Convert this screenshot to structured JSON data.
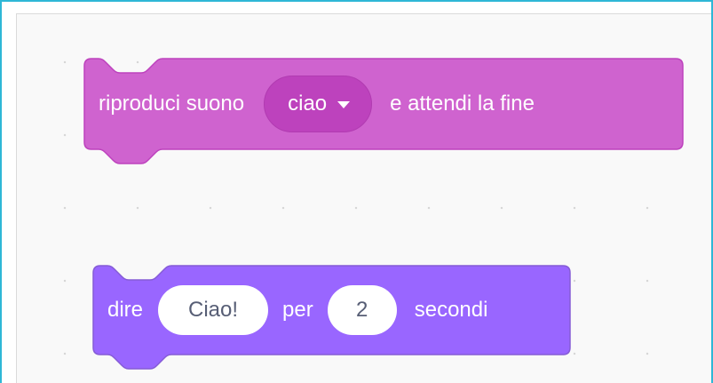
{
  "colors": {
    "sound_block": "#cf63cf",
    "sound_block_border": "#bd42bd",
    "looks_block": "#9966ff",
    "looks_block_border": "#855cd6",
    "workspace_background": "#f9f9f9",
    "frame_border": "#2eb7d6",
    "input_text": "#575e75"
  },
  "blocks": [
    {
      "category": "sound",
      "label_before": "riproduci suono",
      "dropdown": {
        "value": "ciao",
        "icon": "triangle-down-icon"
      },
      "label_after": "e attendi la fine"
    },
    {
      "category": "looks",
      "label_before": "dire",
      "message_input": "Ciao!",
      "label_middle": "per",
      "seconds_input": "2",
      "label_after": "secondi"
    }
  ]
}
